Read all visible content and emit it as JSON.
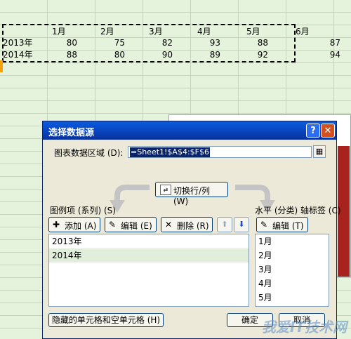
{
  "sheet": {
    "months": [
      "1月",
      "2月",
      "3月",
      "4月",
      "5月",
      "6月"
    ],
    "rows": [
      {
        "label": "2013年",
        "values": [
          "80",
          "75",
          "82",
          "93",
          "88",
          "87"
        ]
      },
      {
        "label": "2014年",
        "values": [
          "88",
          "80",
          "90",
          "89",
          "92",
          "94"
        ]
      }
    ]
  },
  "dialog": {
    "title": "选择数据源",
    "help_label": "?",
    "close_label": "✕",
    "range_label": "图表数据区域 (D):",
    "range_value": "=Sheet1!$A$4:$F$6",
    "collapse_icon": "range-collapse-icon",
    "switch_label": "切换行/列 (W)",
    "legend_label": "图例项 (系列) (S)",
    "legend_toolbar": {
      "add_label": "添加 (A)",
      "edit_label": "编辑 (E)",
      "delete_label": "删除 (R)",
      "up_glyph": "⬆",
      "down_glyph": "⬇"
    },
    "series": [
      "2013年",
      "2014年"
    ],
    "axis_label": "水平 (分类) 轴标签 (C)",
    "axis_edit_label": "编辑 (T)",
    "categories": [
      "1月",
      "2月",
      "3月",
      "4月",
      "5月"
    ],
    "hidden_cells_label": "隐藏的单元格和空单元格 (H)",
    "ok_label": "确定",
    "cancel_label": "取消"
  },
  "watermark": "我爱IT技术网",
  "colors": {
    "accent": "#0a246a",
    "titlebar": "#0a5be0",
    "close": "#d4501f",
    "chart_bar": "#a8221e"
  }
}
